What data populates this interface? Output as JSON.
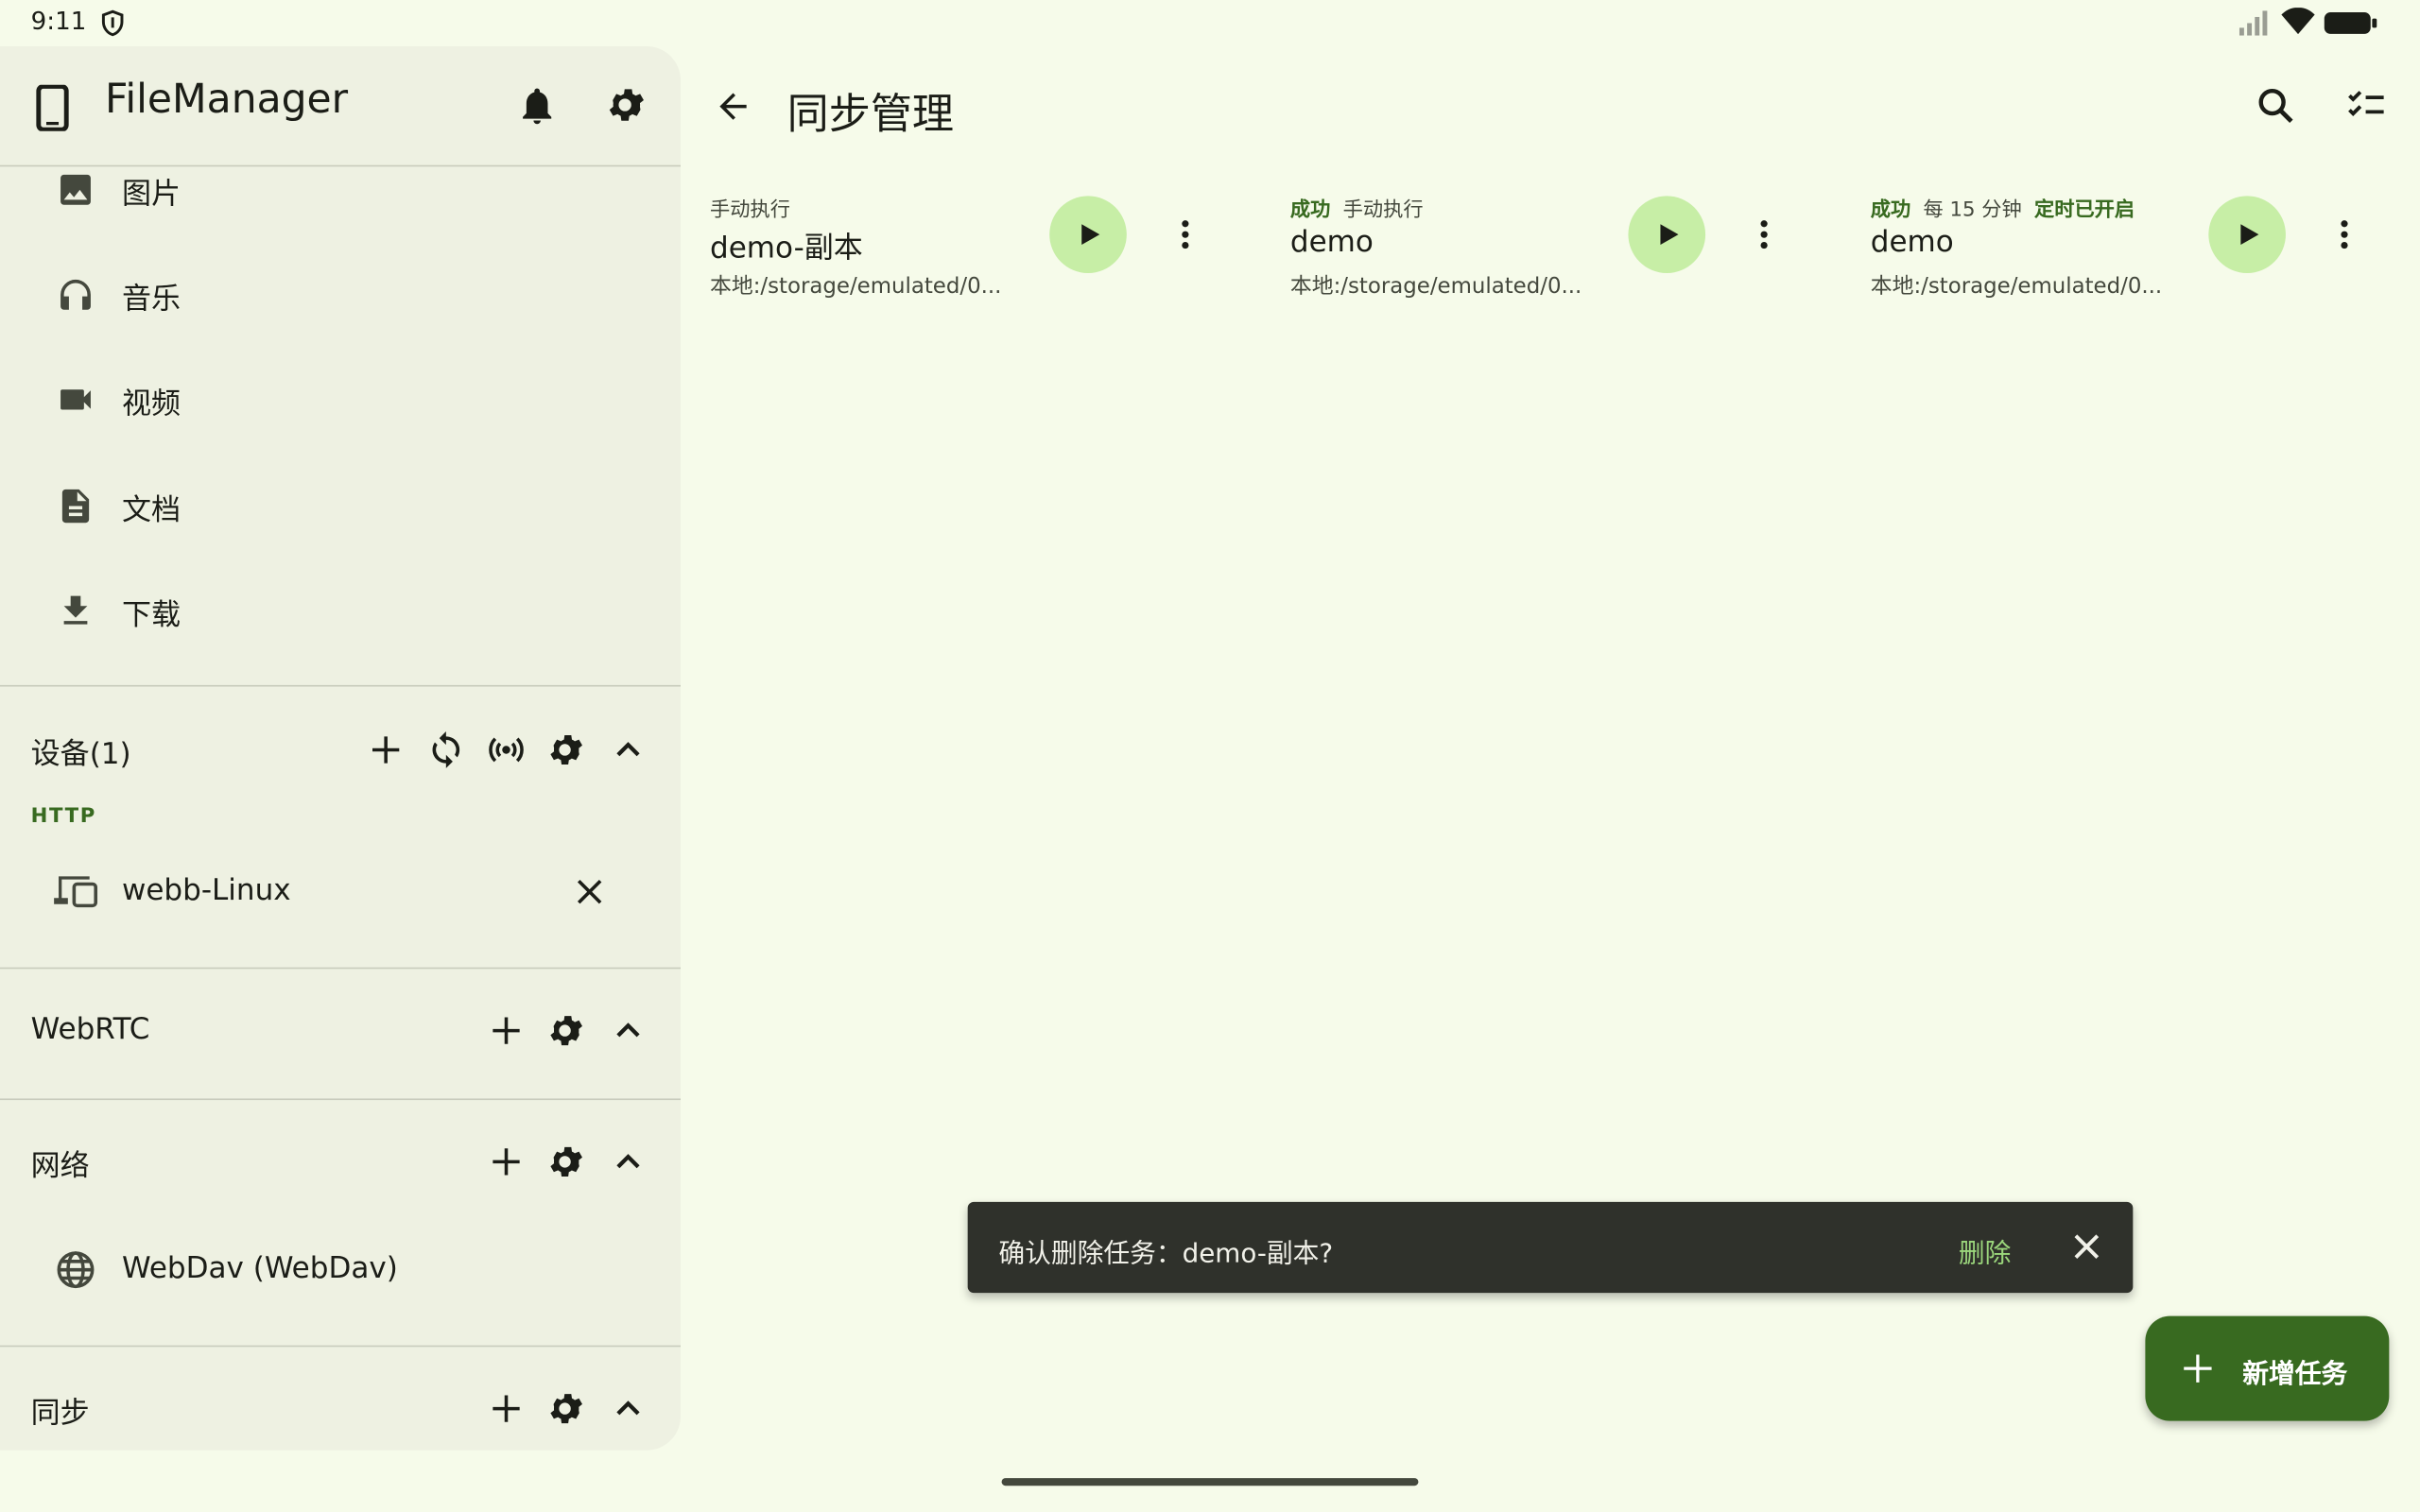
{
  "status_bar": {
    "time": "9:11"
  },
  "drawer": {
    "app_title": "FileManager",
    "nav_items": [
      {
        "label": "图片",
        "icon": "image-icon"
      },
      {
        "label": "音乐",
        "icon": "headphones-icon"
      },
      {
        "label": "视频",
        "icon": "video-camera-icon"
      },
      {
        "label": "文档",
        "icon": "document-icon"
      },
      {
        "label": "下载",
        "icon": "download-icon"
      }
    ],
    "devices": {
      "title": "设备(1)",
      "group_label": "HTTP",
      "items": [
        {
          "label": "webb-Linux",
          "icon": "devices-icon"
        }
      ]
    },
    "webrtc": {
      "title": "WebRTC"
    },
    "network": {
      "title": "网络",
      "items": [
        {
          "label": "WebDav (WebDav)",
          "icon": "globe-icon"
        }
      ]
    },
    "sync": {
      "title": "同步"
    }
  },
  "main": {
    "title": "同步管理",
    "tasks": [
      {
        "status": "",
        "mode": "手动执行",
        "schedule_state": "",
        "name": "demo-副本",
        "path": "本地:/storage/emulated/0..."
      },
      {
        "status": "成功",
        "mode": "手动执行",
        "schedule_state": "",
        "name": "demo",
        "path": "本地:/storage/emulated/0..."
      },
      {
        "status": "成功",
        "mode": "每 15 分钟",
        "schedule_state": "定时已开启",
        "name": "demo",
        "path": "本地:/storage/emulated/0..."
      }
    ]
  },
  "snackbar": {
    "message": "确认删除任务：demo-副本?",
    "action": "删除"
  },
  "fab": {
    "label": "新增任务"
  },
  "colors": {
    "background": "#f6fbea",
    "drawer": "#eef1e2",
    "accent": "#386a20",
    "play_button": "#c7eea6",
    "snackbar": "#2f312b",
    "snackbar_action": "#9bd67c"
  }
}
